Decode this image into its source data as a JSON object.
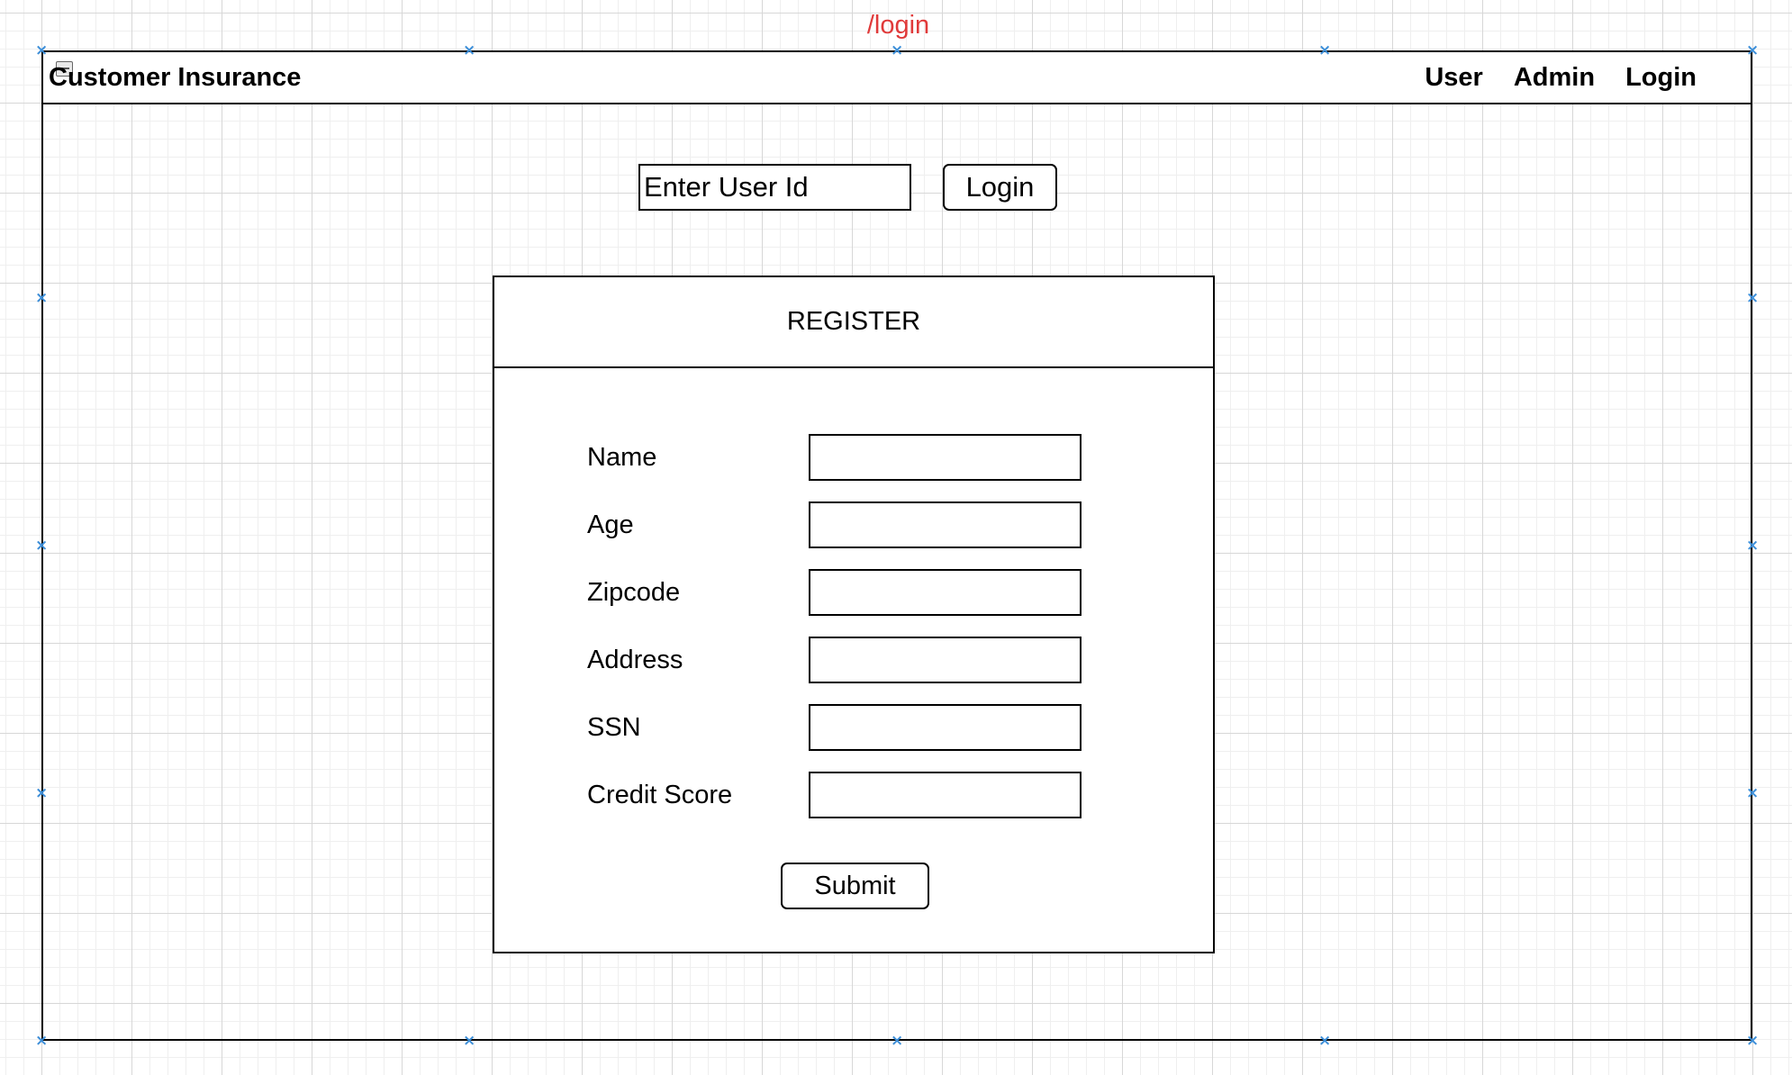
{
  "route": "/login",
  "navbar": {
    "brand": "Customer Insurance",
    "links": [
      "User",
      "Admin",
      "Login"
    ]
  },
  "login": {
    "userid_placeholder": "Enter User Id",
    "button_label": "Login"
  },
  "register": {
    "title": "REGISTER",
    "fields": [
      {
        "label": "Name",
        "value": ""
      },
      {
        "label": "Age",
        "value": ""
      },
      {
        "label": "Zipcode",
        "value": ""
      },
      {
        "label": "Address",
        "value": ""
      },
      {
        "label": "SSN",
        "value": ""
      },
      {
        "label": "Credit Score",
        "value": ""
      }
    ],
    "submit_label": "Submit"
  },
  "colors": {
    "route_label": "#e03a3a",
    "selection_handle": "#3d8fd9",
    "grid_major": "#d7d7d7",
    "grid_minor": "#efefef"
  },
  "icons": {
    "selection_handle": "x-mark-icon",
    "collapse": "collapse-icon"
  }
}
